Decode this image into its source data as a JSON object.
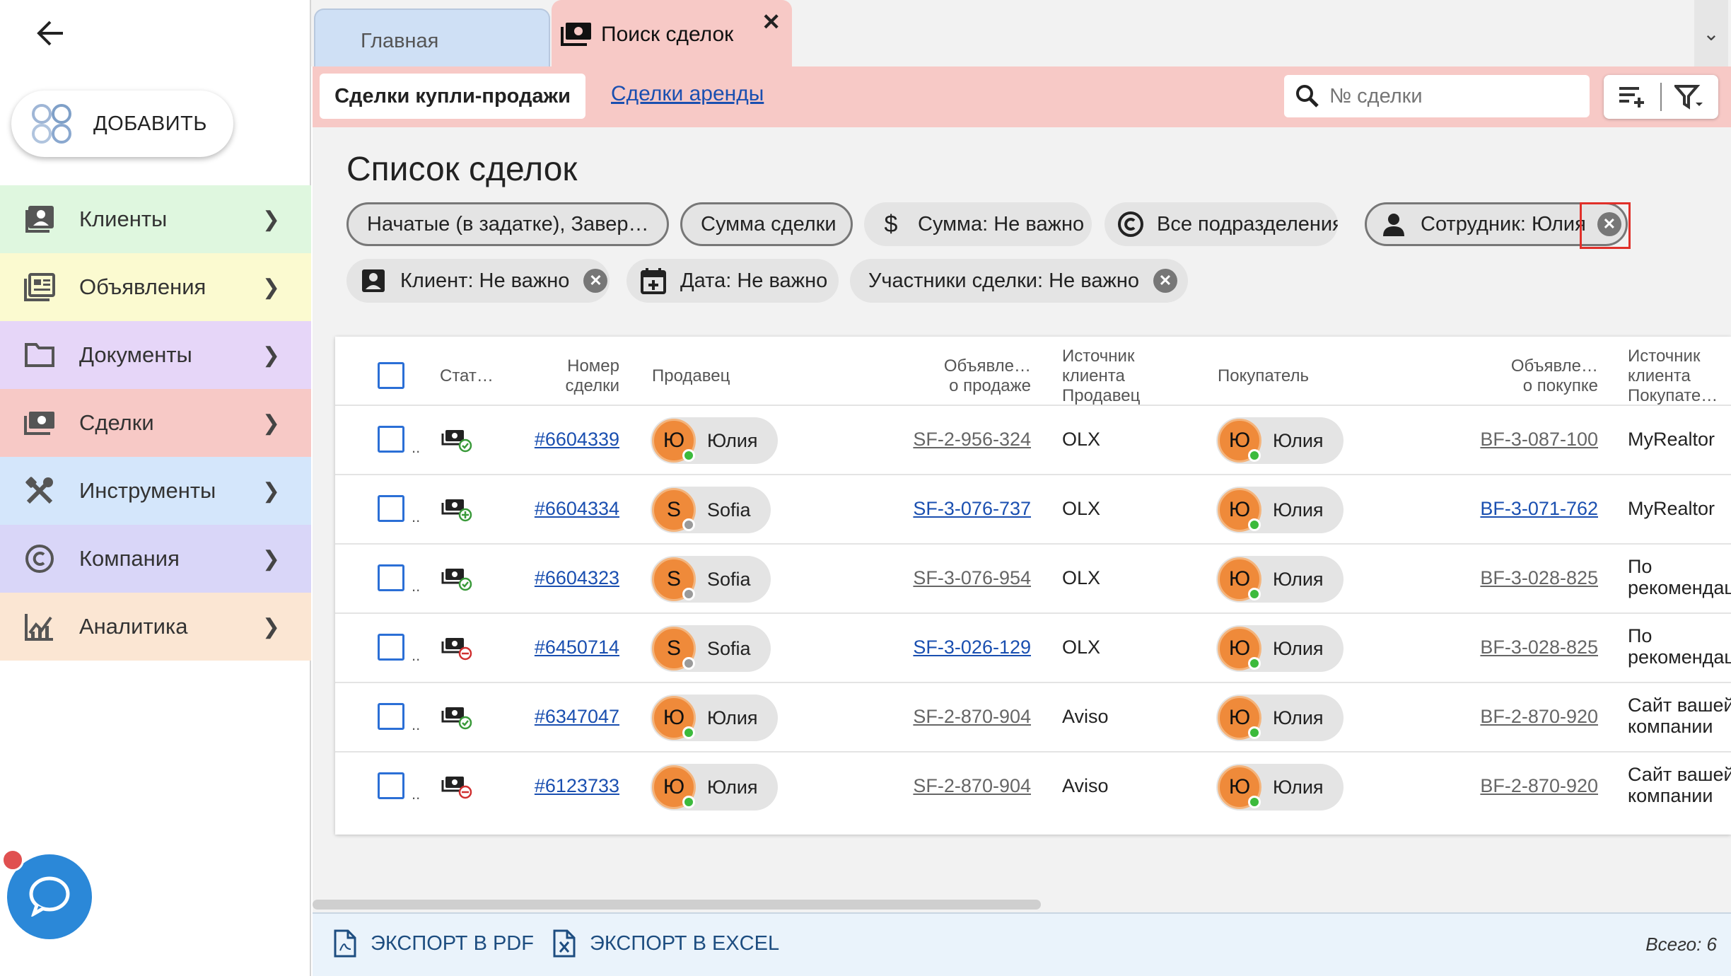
{
  "sidebar": {
    "add_label": "ДОБАВИТЬ",
    "items": [
      {
        "label": "Клиенты",
        "icon": "contacts-icon",
        "color": "#dff7df"
      },
      {
        "label": "Объявления",
        "icon": "listing-icon",
        "color": "#fbfad0"
      },
      {
        "label": "Документы",
        "icon": "folder-icon",
        "color": "#e6d6f8"
      },
      {
        "label": "Сделки",
        "icon": "money-icon",
        "color": "#f7c9c6"
      },
      {
        "label": "Инструменты",
        "icon": "tools-icon",
        "color": "#d4e6fb"
      },
      {
        "label": "Компания",
        "icon": "copyright-icon",
        "color": "#d9d6f8"
      },
      {
        "label": "Аналитика",
        "icon": "analytics-icon",
        "color": "#fbe6d3"
      }
    ]
  },
  "tabs": {
    "home": "Главная",
    "deals_search": "Поиск сделок",
    "close": "✕"
  },
  "subbar": {
    "sale_deals": "Сделки купли-продажи",
    "rent_deals": "Сделки аренды",
    "search_placeholder": "№ сделки"
  },
  "page_title": "Список сделок",
  "filters": {
    "status": "Начатые (в задатке), Завер…",
    "deal_sum": "Сумма сделки",
    "sum": "Сумма: Не важно",
    "divisions": "Все подразделения",
    "employee": "Сотрудник: Юлия",
    "client": "Клиент: Не важно",
    "date": "Дата: Не важно",
    "participants": "Участники сделки: Не важно"
  },
  "table": {
    "headers": {
      "status": "Стат…",
      "number": [
        "Номер",
        "сделки"
      ],
      "seller": "Продавец",
      "sale_listing": [
        "Объявле…",
        "о продаже"
      ],
      "seller_source": [
        "Источник",
        "клиента",
        "Продавец"
      ],
      "buyer": "Покупатель",
      "buy_listing": [
        "Объявле…",
        "о покупке"
      ],
      "buyer_source": [
        "Источник",
        "клиента",
        "Покупате…"
      ]
    },
    "rows": [
      {
        "number": "#6604339",
        "status_icon": "deal-completed-icon",
        "seller": {
          "initial": "Ю",
          "name": "Юлия",
          "online": true
        },
        "sale_listing": "SF-2-956-324",
        "sale_active": false,
        "seller_source": "OLX",
        "buyer": {
          "initial": "Ю",
          "name": "Юлия",
          "online": true
        },
        "buy_listing": "BF-3-087-100",
        "buy_active": false,
        "buyer_source": [
          "MyRealtor"
        ]
      },
      {
        "number": "#6604334",
        "status_icon": "deal-started-icon",
        "seller": {
          "initial": "S",
          "name": "Sofia",
          "online": false
        },
        "sale_listing": "SF-3-076-737",
        "sale_active": true,
        "seller_source": "OLX",
        "buyer": {
          "initial": "Ю",
          "name": "Юлия",
          "online": true
        },
        "buy_listing": "BF-3-071-762",
        "buy_active": true,
        "buyer_source": [
          "MyRealtor"
        ]
      },
      {
        "number": "#6604323",
        "status_icon": "deal-completed-icon",
        "seller": {
          "initial": "S",
          "name": "Sofia",
          "online": false
        },
        "sale_listing": "SF-3-076-954",
        "sale_active": false,
        "seller_source": "OLX",
        "buyer": {
          "initial": "Ю",
          "name": "Юлия",
          "online": true
        },
        "buy_listing": "BF-3-028-825",
        "buy_active": false,
        "buyer_source": [
          "По",
          "рекомендации"
        ]
      },
      {
        "number": "#6450714",
        "status_icon": "deal-cancelled-icon",
        "seller": {
          "initial": "S",
          "name": "Sofia",
          "online": false
        },
        "sale_listing": "SF-3-026-129",
        "sale_active": true,
        "seller_source": "OLX",
        "buyer": {
          "initial": "Ю",
          "name": "Юлия",
          "online": true
        },
        "buy_listing": "BF-3-028-825",
        "buy_active": false,
        "buyer_source": [
          "По",
          "рекомендации"
        ]
      },
      {
        "number": "#6347047",
        "status_icon": "deal-completed-icon",
        "seller": {
          "initial": "Ю",
          "name": "Юлия",
          "online": true
        },
        "sale_listing": "SF-2-870-904",
        "sale_active": false,
        "seller_source": "Aviso",
        "buyer": {
          "initial": "Ю",
          "name": "Юлия",
          "online": true
        },
        "buy_listing": "BF-2-870-920",
        "buy_active": false,
        "buyer_source": [
          "Сайт вашей",
          "компании"
        ]
      },
      {
        "number": "#6123733",
        "status_icon": "deal-cancelled-icon",
        "seller": {
          "initial": "Ю",
          "name": "Юлия",
          "online": true
        },
        "sale_listing": "SF-2-870-904",
        "sale_active": false,
        "seller_source": "Aviso",
        "buyer": {
          "initial": "Ю",
          "name": "Юлия",
          "online": true
        },
        "buy_listing": "BF-2-870-920",
        "buy_active": false,
        "buyer_source": [
          "Сайт вашей",
          "компании"
        ]
      }
    ]
  },
  "footer": {
    "export_pdf": "ЭКСПОРТ В PDF",
    "export_excel": "ЭКСПОРТ В EXCEL",
    "total": "Всего: 6"
  },
  "colors": {
    "accent_blue": "#2b6fd6",
    "link_blue": "#1a4fb0",
    "tab_pink": "#f7c9c6",
    "avatar_orange": "#ef8a3a",
    "highlight_red": "#e0302a"
  }
}
